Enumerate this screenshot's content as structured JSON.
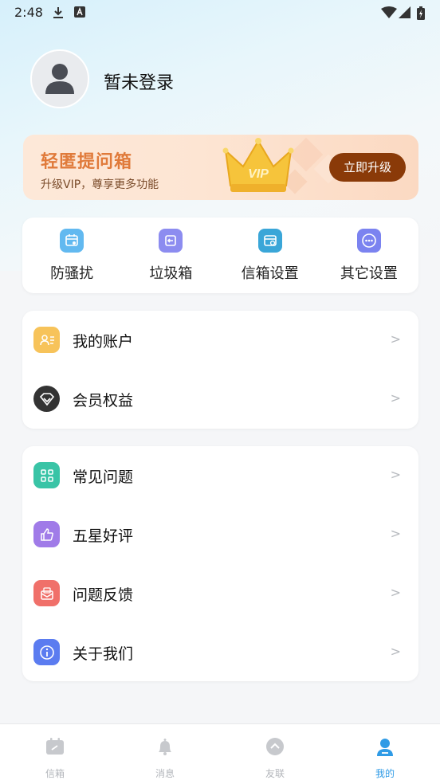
{
  "status_bar": {
    "time": "2:48"
  },
  "profile": {
    "login_text": "暂未登录"
  },
  "vip_banner": {
    "title": "轻匿提问箱",
    "subtitle": "升级VIP，尊享更多功能",
    "crown_text": "VIP",
    "button_label": "立即升级"
  },
  "quick_actions": [
    {
      "label": "防骚扰",
      "icon": "shield-calendar-icon",
      "color": "#62b9f0"
    },
    {
      "label": "垃圾箱",
      "icon": "trash-return-icon",
      "color": "#8c8cf0"
    },
    {
      "label": "信箱设置",
      "icon": "mailbox-settings-icon",
      "color": "#3aa6d8"
    },
    {
      "label": "其它设置",
      "icon": "more-dots-icon",
      "color": "#7b83f0"
    }
  ],
  "menu_group_1": [
    {
      "label": "我的账户",
      "icon": "account-card-icon",
      "color": "#f7c35a",
      "arrow": ">"
    },
    {
      "label": "会员权益",
      "icon": "diamond-icon",
      "color": "#333333",
      "arrow": ">"
    }
  ],
  "menu_group_2": [
    {
      "label": "常见问题",
      "icon": "grid-faq-icon",
      "color": "#39c4a6",
      "arrow": ">"
    },
    {
      "label": "五星好评",
      "icon": "thumbs-up-icon",
      "color": "#a07be8",
      "arrow": ">"
    },
    {
      "label": "问题反馈",
      "icon": "feedback-envelope-icon",
      "color": "#f0706a",
      "arrow": ">"
    },
    {
      "label": "关于我们",
      "icon": "info-icon",
      "color": "#5b7cf0",
      "arrow": ">"
    }
  ],
  "tab_bar": [
    {
      "label": "信箱",
      "icon": "mailbox-icon",
      "active": false
    },
    {
      "label": "消息",
      "icon": "bell-icon",
      "active": false
    },
    {
      "label": "友联",
      "icon": "friends-circle-icon",
      "active": false
    },
    {
      "label": "我的",
      "icon": "profile-icon",
      "active": true
    }
  ],
  "colors": {
    "accent": "#2f9be6",
    "vip_button": "#8a3a08",
    "vip_title": "#e07a3a"
  }
}
